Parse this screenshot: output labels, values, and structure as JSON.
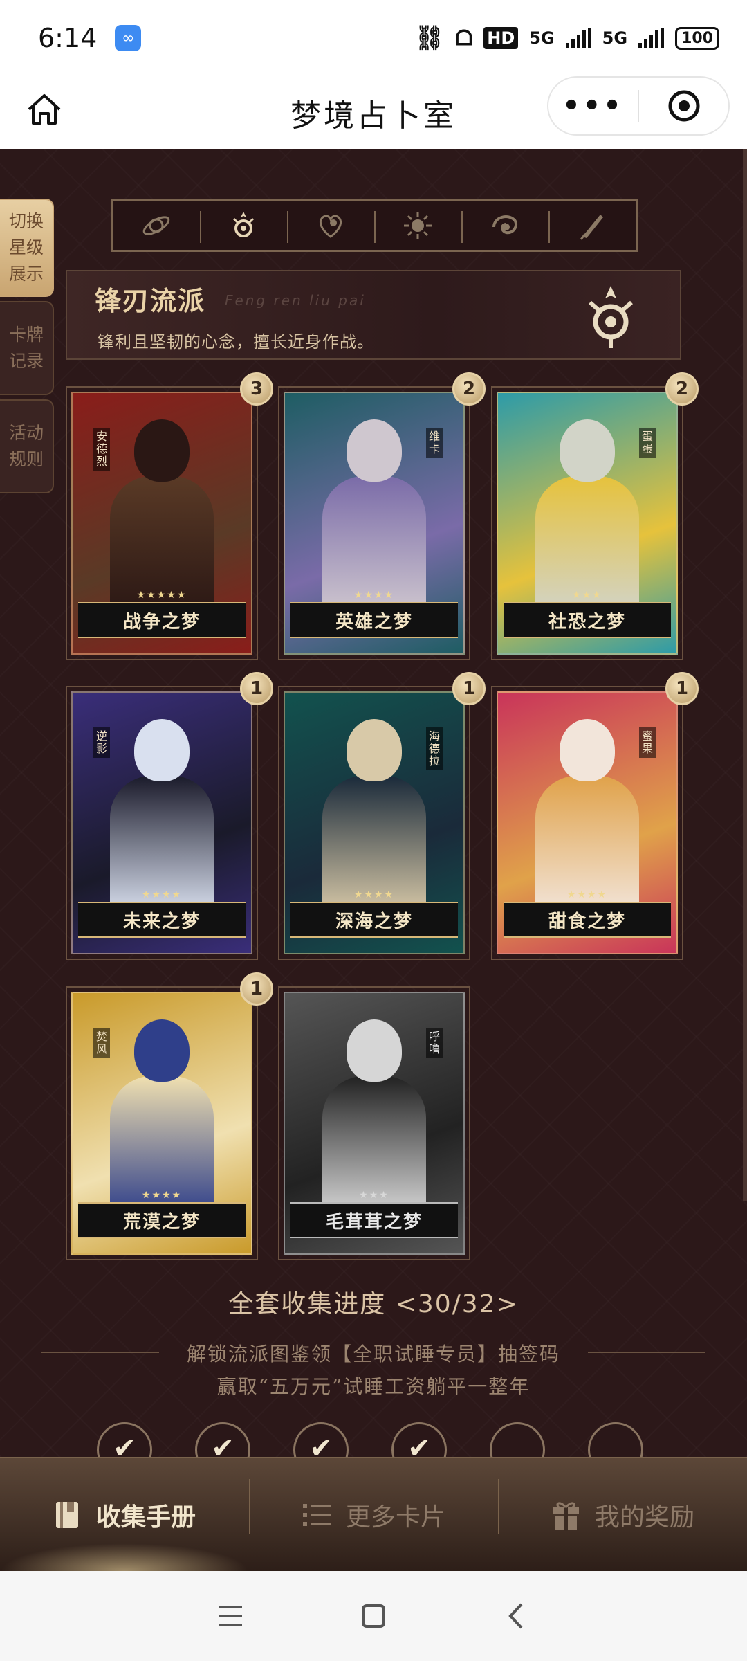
{
  "status_bar": {
    "time": "6:14",
    "network": "5G",
    "hd": "HD",
    "battery": "100"
  },
  "header": {
    "title": "梦境占卜室",
    "more_icon": "more-dots-icon",
    "target_icon": "record-target-icon"
  },
  "side_tabs": [
    {
      "label": "切换星级展示",
      "active": true
    },
    {
      "label": "卡牌记录",
      "active": false
    },
    {
      "label": "活动规则",
      "active": false
    }
  ],
  "faction_icons": [
    "orbit-icon",
    "blade-emblem-icon",
    "heart-ghost-icon",
    "sun-icon",
    "swirl-icon",
    "quill-icon"
  ],
  "faction": {
    "title": "锋刃流派",
    "subtitle": "Feng ren liu pai",
    "description": "锋利且坚韧的心念，擅长近身作战。"
  },
  "cards": [
    {
      "name": "战争之梦",
      "side_label": "安德烈",
      "count": "3",
      "stars": "★★★★★",
      "grayscale": false,
      "colors": [
        "#8a1d1a",
        "#2a1714",
        "#5a3a26"
      ]
    },
    {
      "name": "英雄之梦",
      "side_label": "维卡",
      "count": "2",
      "stars": "★★★★",
      "grayscale": false,
      "colors": [
        "#1e5d63",
        "#cfc7cf",
        "#7a6ba8"
      ]
    },
    {
      "name": "社恐之梦",
      "side_label": "蛋蛋",
      "count": "2",
      "stars": "★★★",
      "grayscale": false,
      "colors": [
        "#2d9ba8",
        "#d2d4c8",
        "#e6c23c"
      ]
    },
    {
      "name": "未来之梦",
      "side_label": "逆影",
      "count": "1",
      "stars": "★★★★",
      "grayscale": false,
      "colors": [
        "#3a2e7a",
        "#d9e0ef",
        "#1a1a2a"
      ]
    },
    {
      "name": "深海之梦",
      "side_label": "海德拉",
      "count": "1",
      "stars": "★★★★",
      "grayscale": false,
      "colors": [
        "#12524e",
        "#d8c9a8",
        "#1a2a3a"
      ]
    },
    {
      "name": "甜食之梦",
      "side_label": "蜜果",
      "count": "1",
      "stars": "★★★★",
      "grayscale": false,
      "colors": [
        "#c9345a",
        "#f2e5da",
        "#e0a24a"
      ]
    },
    {
      "name": "荒漠之梦",
      "side_label": "焚风",
      "count": "1",
      "stars": "★★★★",
      "grayscale": false,
      "colors": [
        "#c99a2a",
        "#2f3f8a",
        "#f0e0b0"
      ]
    },
    {
      "name": "毛茸茸之梦",
      "side_label": "呼噜",
      "count": "",
      "stars": "★★★",
      "grayscale": true,
      "colors": [
        "#555555",
        "#d6d6d6",
        "#222222"
      ]
    }
  ],
  "progress": {
    "text": "全套收集进度 <30/32>"
  },
  "unlock": {
    "line1": "解锁流派图鉴领【全职试睡专员】抽签码",
    "line2": "赢取“五万元”试睡工资躺平一整年"
  },
  "milestones": [
    true,
    true,
    true,
    true,
    false,
    false
  ],
  "bottom_nav": [
    {
      "label": "收集手册",
      "icon": "book-icon",
      "active": true
    },
    {
      "label": "更多卡片",
      "icon": "list-icon",
      "active": false
    },
    {
      "label": "我的奖励",
      "icon": "gift-icon",
      "active": false
    }
  ],
  "system_nav": [
    "menu-icon",
    "home-square-icon",
    "back-icon"
  ]
}
